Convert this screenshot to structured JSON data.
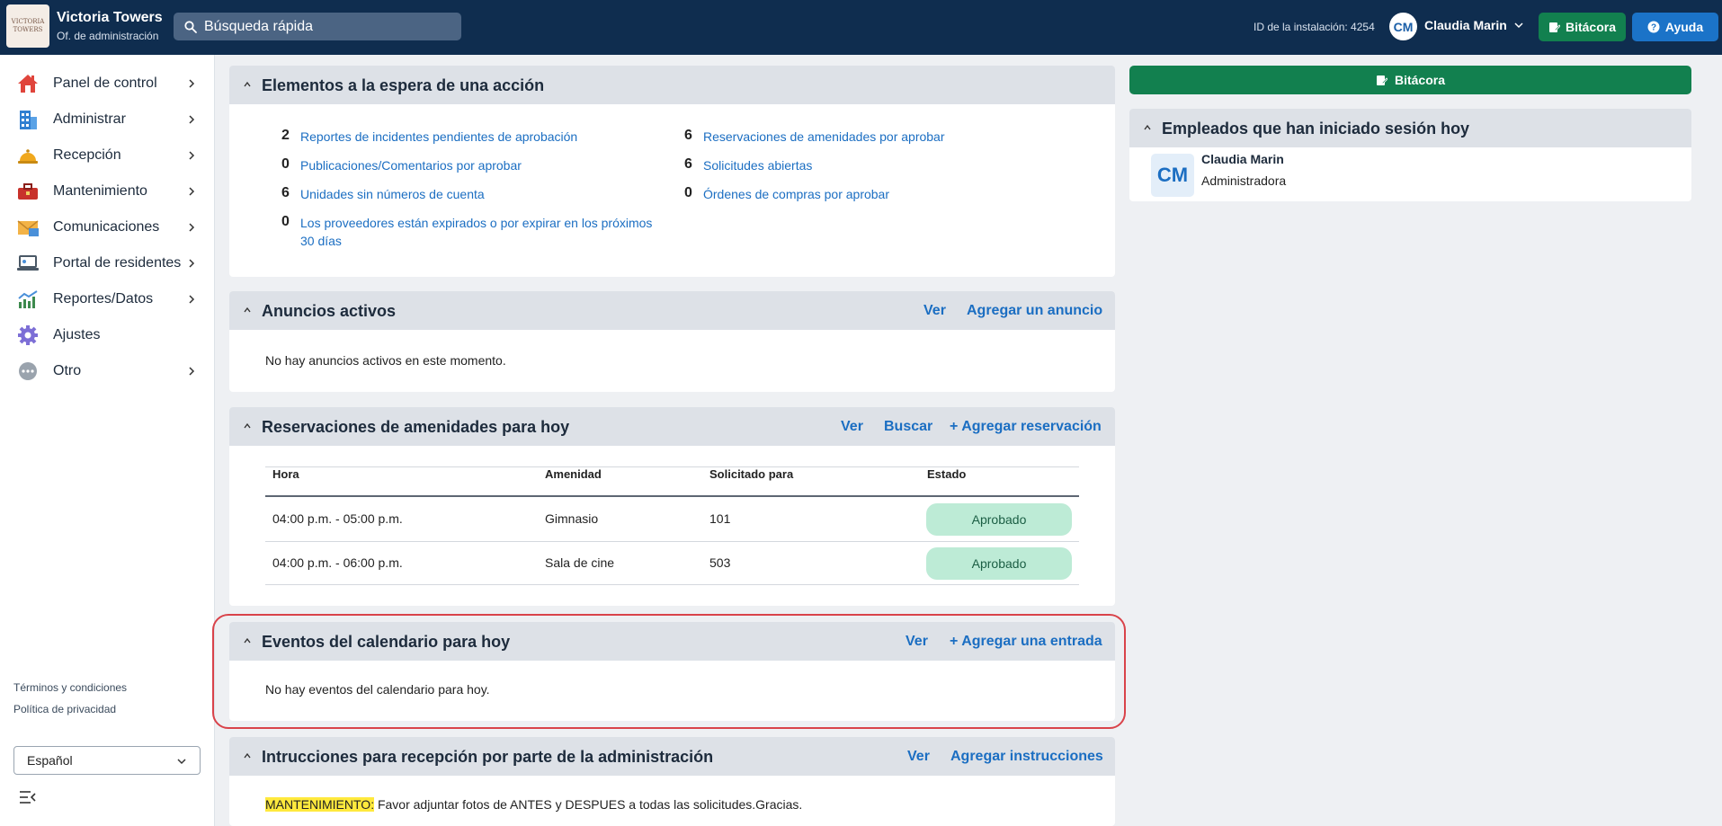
{
  "app": {
    "brand_title": "Victoria Towers",
    "brand_subtitle": "Of. de administración",
    "logo_text": "VICTORIA TOWERS",
    "search_placeholder": "Búsqueda rápida",
    "install_id": "ID de la instalación: 4254",
    "user_initials": "CM",
    "user_name": "Claudia Marin",
    "bitacora_label": "Bitácora",
    "ayuda_label": "Ayuda"
  },
  "sidebar": {
    "items": [
      {
        "label": "Panel de control",
        "icon": "house-icon",
        "has_chevron": true
      },
      {
        "label": "Administrar",
        "icon": "building-icon",
        "has_chevron": true
      },
      {
        "label": "Recepción",
        "icon": "service-bell-icon",
        "has_chevron": true
      },
      {
        "label": "Mantenimiento",
        "icon": "toolbox-icon",
        "has_chevron": true
      },
      {
        "label": "Comunicaciones",
        "icon": "envelope-icon",
        "has_chevron": true
      },
      {
        "label": "Portal de residentes",
        "icon": "laptop-icon",
        "has_chevron": true
      },
      {
        "label": "Reportes/Datos",
        "icon": "chart-icon",
        "has_chevron": true
      },
      {
        "label": "Ajustes",
        "icon": "gear-icon",
        "has_chevron": false
      },
      {
        "label": "Otro",
        "icon": "more-icon",
        "has_chevron": true
      }
    ],
    "terms": "Términos y condiciones",
    "privacy": "Política de privacidad",
    "language": "Español"
  },
  "pending": {
    "title": "Elementos a la espera de una acción",
    "left": [
      {
        "count": "2",
        "label": "Reportes de incidentes pendientes de aprobación"
      },
      {
        "count": "0",
        "label": "Publicaciones/Comentarios por aprobar"
      },
      {
        "count": "6",
        "label": "Unidades sin números de cuenta"
      },
      {
        "count": "0",
        "label": "Los proveedores están expirados o por expirar en los próximos",
        "label2": "30 días"
      }
    ],
    "right": [
      {
        "count": "6",
        "label": "Reservaciones de amenidades por aprobar"
      },
      {
        "count": "6",
        "label": "Solicitudes abiertas"
      },
      {
        "count": "0",
        "label": "Órdenes de compras por aprobar"
      }
    ]
  },
  "announcements": {
    "title": "Anuncios activos",
    "ver": "Ver",
    "add": "Agregar un anuncio",
    "empty": "No hay anuncios activos en este momento."
  },
  "reservations": {
    "title": "Reservaciones de amenidades para hoy",
    "ver": "Ver",
    "buscar": "Buscar",
    "add": "+ Agregar reservación",
    "columns": [
      "Hora",
      "Amenidad",
      "Solicitado para",
      "Estado"
    ],
    "rows": [
      {
        "hora": "04:00 p.m. - 05:00 p.m.",
        "amenidad": "Gimnasio",
        "solicitado": "101",
        "estado": "Aprobado"
      },
      {
        "hora": "04:00 p.m. - 06:00 p.m.",
        "amenidad": "Sala de cine",
        "solicitado": "503",
        "estado": "Aprobado"
      }
    ]
  },
  "calendar": {
    "title": "Eventos del calendario para hoy",
    "ver": "Ver",
    "add": "+ Agregar una entrada",
    "empty": "No hay eventos del calendario para hoy."
  },
  "instructions": {
    "title": "Intrucciones para recepción por parte de la administración",
    "ver": "Ver",
    "add": "Agregar instrucciones",
    "highlight": "MANTENIMIENTO:",
    "text": " Favor adjuntar fotos de ANTES y DESPUES a todas las solicitudes.Gracias."
  },
  "right_panel": {
    "bitacora_label": "Bitácora",
    "employees_title": "Empleados que han iniciado sesión hoy",
    "employee": {
      "initials": "CM",
      "name": "Claudia Marin",
      "role": "Administradora"
    }
  },
  "colors": {
    "topbar": "#0f2d4f",
    "green": "#12804f",
    "blue": "#1b73c8",
    "link": "#1b6ec2",
    "pill": "#bdebd6",
    "highlight_ring": "#d9434a"
  }
}
